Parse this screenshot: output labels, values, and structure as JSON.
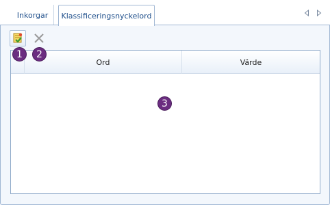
{
  "tabs": [
    {
      "label": "Inkorgar",
      "active": false
    },
    {
      "label": "Klassificeringsnyckelord",
      "active": true
    }
  ],
  "toolbar": {
    "add_icon": "add-keyword-icon",
    "delete_icon": "delete-x-icon",
    "delete_enabled": false
  },
  "grid": {
    "columns": [
      "Ord",
      "Värde"
    ],
    "rows": []
  },
  "callouts": [
    "1",
    "2",
    "3"
  ],
  "colors": {
    "tab_text": "#1f4f8b",
    "border": "#9fb6d3",
    "badge": "#6b2d80"
  }
}
